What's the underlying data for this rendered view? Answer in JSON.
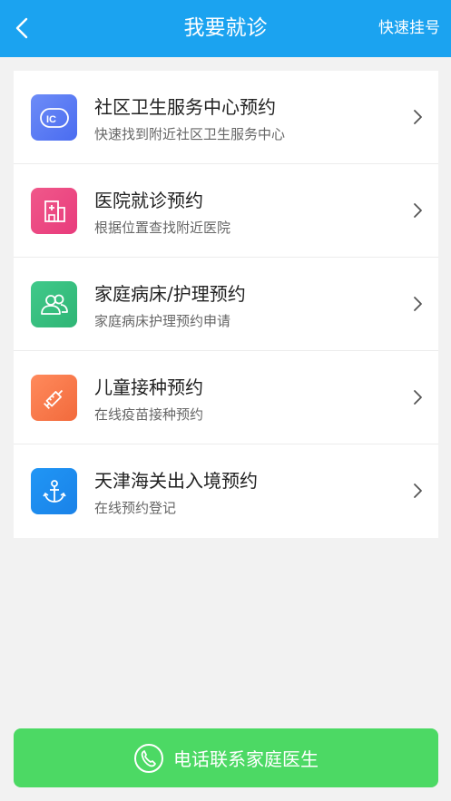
{
  "header": {
    "title": "我要就诊",
    "quick_register": "快速挂号",
    "background": "#1ba3f0"
  },
  "items": [
    {
      "title": "社区卫生服务中心预约",
      "subtitle": "快速找到附近社区卫生服务中心",
      "icon": "community-health-icon",
      "color_from": "#6d8cf7",
      "color_to": "#4a6cf0"
    },
    {
      "title": "医院就诊预约",
      "subtitle": "根据位置查找附近医院",
      "icon": "hospital-icon",
      "color_from": "#f0588a",
      "color_to": "#e83b7c"
    },
    {
      "title": "家庭病床/护理预约",
      "subtitle": "家庭病床护理预约申请",
      "icon": "people-icon",
      "color_from": "#40c98a",
      "color_to": "#2fb575"
    },
    {
      "title": "儿童接种预约",
      "subtitle": "在线疫苗接种预约",
      "icon": "syringe-icon",
      "color_from": "#ff8a5c",
      "color_to": "#f26a3c"
    },
    {
      "title": "天津海关出入境预约",
      "subtitle": "在线预约登记",
      "icon": "anchor-icon",
      "color_from": "#2096f5",
      "color_to": "#1a82e8"
    }
  ],
  "call_button": {
    "label": "电话联系家庭医生",
    "icon": "phone-icon",
    "color": "#4cd964"
  }
}
